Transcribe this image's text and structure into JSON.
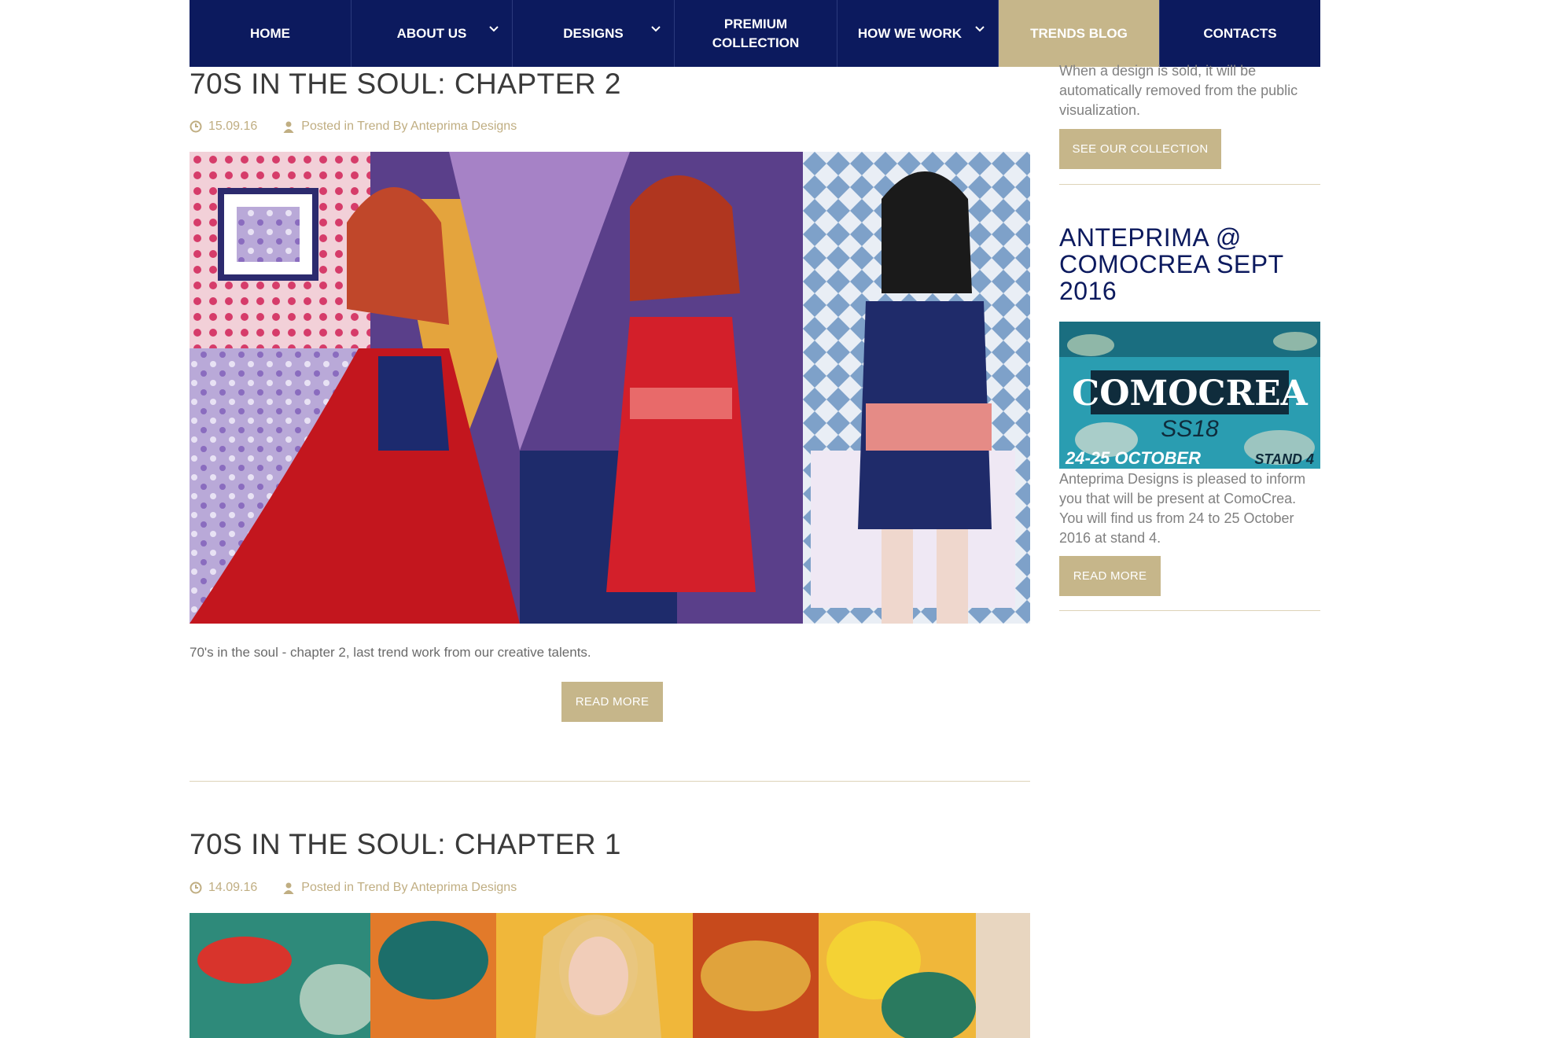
{
  "nav": {
    "items": [
      {
        "label": "HOME"
      },
      {
        "label": "ABOUT US"
      },
      {
        "label": "DESIGNS"
      },
      {
        "label": "PREMIUM COLLECTION"
      },
      {
        "label": "HOW WE WORK"
      },
      {
        "label": "TRENDS BLOG"
      },
      {
        "label": "CONTACTS"
      }
    ],
    "active": "TRENDS BLOG",
    "accent": "#c6b68a",
    "background": "#0c1a5e"
  },
  "posts": [
    {
      "title": "70S IN THE SOUL: CHAPTER 2",
      "date": "15.09.16",
      "posted_in": "Posted in Trend By Anteprima Designs",
      "excerpt": "70's in the soul - chapter 2, last trend work from our creative talents.",
      "read_more": "READ MORE"
    },
    {
      "title": "70S IN THE SOUL: CHAPTER 1",
      "date": "14.09.16",
      "posted_in": "Posted in Trend By Anteprima Designs"
    }
  ],
  "sidebar": {
    "collection_text": "When a design is sold, it will be automatically removed from the public visualization.",
    "collection_button": "SEE OUR COLLECTION",
    "event_heading": "ANTEPRIMA @ COMOCREA SEPT 2016",
    "banner": {
      "title": "COMOCREA",
      "season": "SS18",
      "dates": "24-25 OCTOBER",
      "stand": "STAND 4"
    },
    "event_text": "Anteprima Designs is pleased to inform you that will be present at ComoCrea. You will find us from 24 to 25 October 2016 at stand 4.",
    "event_button": "READ MORE"
  },
  "icons": {
    "date": "clock-icon",
    "author": "user-icon",
    "dropdown": "chevron-down-icon"
  }
}
